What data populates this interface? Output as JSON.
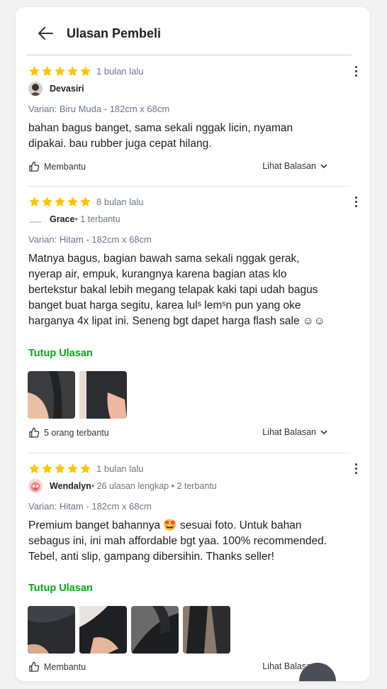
{
  "header": {
    "title": "Ulasan Pembeli"
  },
  "reviews": [
    {
      "date": "1 bulan lalu",
      "username": "Devasiri",
      "meta": "",
      "variant": "Varian: Biru Muda - 182cm x 68cm",
      "text": "bahan bagus banget, sama sekali nggak licin, nyaman dipakai. bau rubber juga cepat hilang.",
      "toggle": "",
      "helpful": "Membantu",
      "replies": "Lihat Balasan"
    },
    {
      "date": "8 bulan lalu",
      "username": "Grace",
      "meta": " • 1 terbantu",
      "variant": "Varian: Hitam - 182cm x 68cm",
      "text": "Matnya bagus, bagian bawah sama sekali nggak gerak, nyerap air, empuk, kurangnya karena bagian atas klo bertekstur bakal lebih megang telapak kaki tapi udah bagus banget buat harga segitu, karea lulˢ lemˢn pun yang oke harganya 4x lipat ini. Seneng bgt dapet harga flash sale ☺☺",
      "toggle": "Tutup Ulasan",
      "helpful": "5 orang terbantu",
      "replies": "Lihat Balasan"
    },
    {
      "date": "1 bulan lalu",
      "username": "Wendalyn",
      "meta": " • 26 ulasan lengkap • 2 terbantu",
      "variant": "Varian: Hitam - 182cm x 68cm",
      "text": "Premium banget bahannya 🤩 sesuai foto. Untuk bahan sebagus ini, ini mah affordable bgt yaa. 100% recommended. Tebel, anti slip, gampang dibersihin. Thanks seller!",
      "toggle": "Tutup Ulasan",
      "helpful": "Membantu",
      "replies": "Lihat Balasan"
    }
  ],
  "colors": {
    "star": "#ffc400",
    "accent": "#03ac0e",
    "muted": "#6d7588"
  },
  "icons": [
    "arrow-left-icon",
    "star-icon",
    "more-vertical-icon",
    "thumbs-up-icon",
    "chevron-down-icon"
  ]
}
